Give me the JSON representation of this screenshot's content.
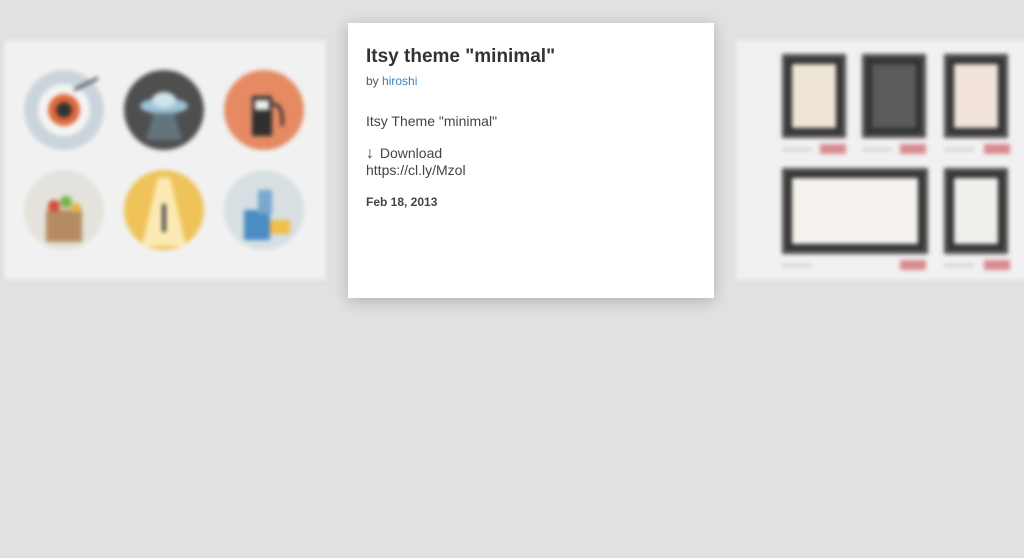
{
  "post": {
    "title": "Itsy theme \"minimal\"",
    "by_prefix": "by",
    "author": "hiroshi",
    "body": "Itsy Theme \"minimal\"",
    "download_arrow": "↓",
    "download_label": "Download",
    "download_url": "https://cl.ly/Mzol",
    "date": "Feb 18, 2013"
  },
  "background": {
    "left_card": {
      "icons": [
        "sushi-plate-icon",
        "ufo-icon",
        "gas-pump-icon",
        "grocery-bag-icon",
        "spotlight-icon",
        "building-blocks-icon"
      ],
      "colors": [
        "#c9d4dc",
        "#4f4f4f",
        "#e58a62",
        "#e4e2dc",
        "#efc35a",
        "#d7dfe3"
      ]
    },
    "right_card": {
      "items": [
        "framed-art-1",
        "framed-art-2",
        "framed-art-3",
        "framed-art-4",
        "framed-art-5"
      ],
      "tag_color": "#d98a8f"
    }
  }
}
